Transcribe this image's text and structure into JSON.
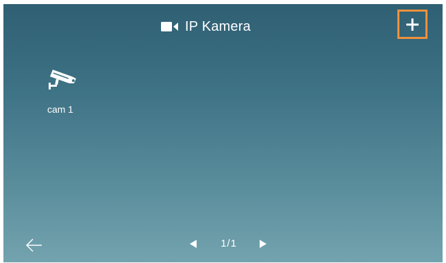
{
  "header": {
    "title": "IP Kamera",
    "title_icon": "video-camera-icon",
    "add_icon": "plus-icon"
  },
  "cameras": [
    {
      "label": "cam 1",
      "icon": "security-camera-icon"
    }
  ],
  "footer": {
    "back_icon": "arrow-left-icon",
    "prev_icon": "triangle-left-icon",
    "next_icon": "triangle-right-icon",
    "page_indicator": "1/1"
  },
  "colors": {
    "highlight": "#f0913d",
    "background_top": "#2f5f73",
    "background_bottom": "#73a3ae",
    "foreground": "#ffffff"
  }
}
